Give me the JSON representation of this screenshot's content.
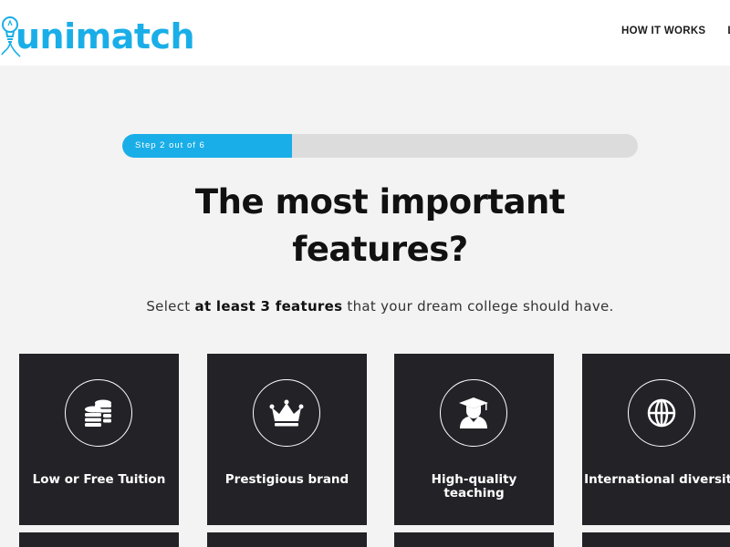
{
  "header": {
    "logo_text": "unimatch",
    "nav": [
      {
        "label": "HOW IT WORKS"
      },
      {
        "label": "LO"
      }
    ]
  },
  "progress": {
    "label": "Step 2 out of 6",
    "current_step": 2,
    "total_steps": 6,
    "fraction_shown": 0.33,
    "fill_color": "#1aaee8",
    "track_color": "#dcdcdc"
  },
  "main": {
    "title_line1": "The most important",
    "title_line2": "features?",
    "subtitle_pre": "Select ",
    "subtitle_bold": "at least 3 features",
    "subtitle_post": " that your dream college should have."
  },
  "features": [
    {
      "label": "Low or Free Tuition",
      "icon": "coins-icon"
    },
    {
      "label": "Prestigious brand",
      "icon": "crown-icon"
    },
    {
      "label": "High-quality teaching",
      "icon": "graduate-icon"
    },
    {
      "label": "International diversity",
      "icon": "globe-icon"
    }
  ],
  "colors": {
    "accent": "#1aaee8",
    "card_bg": "#232227",
    "page_bg": "#f3f3f3"
  }
}
